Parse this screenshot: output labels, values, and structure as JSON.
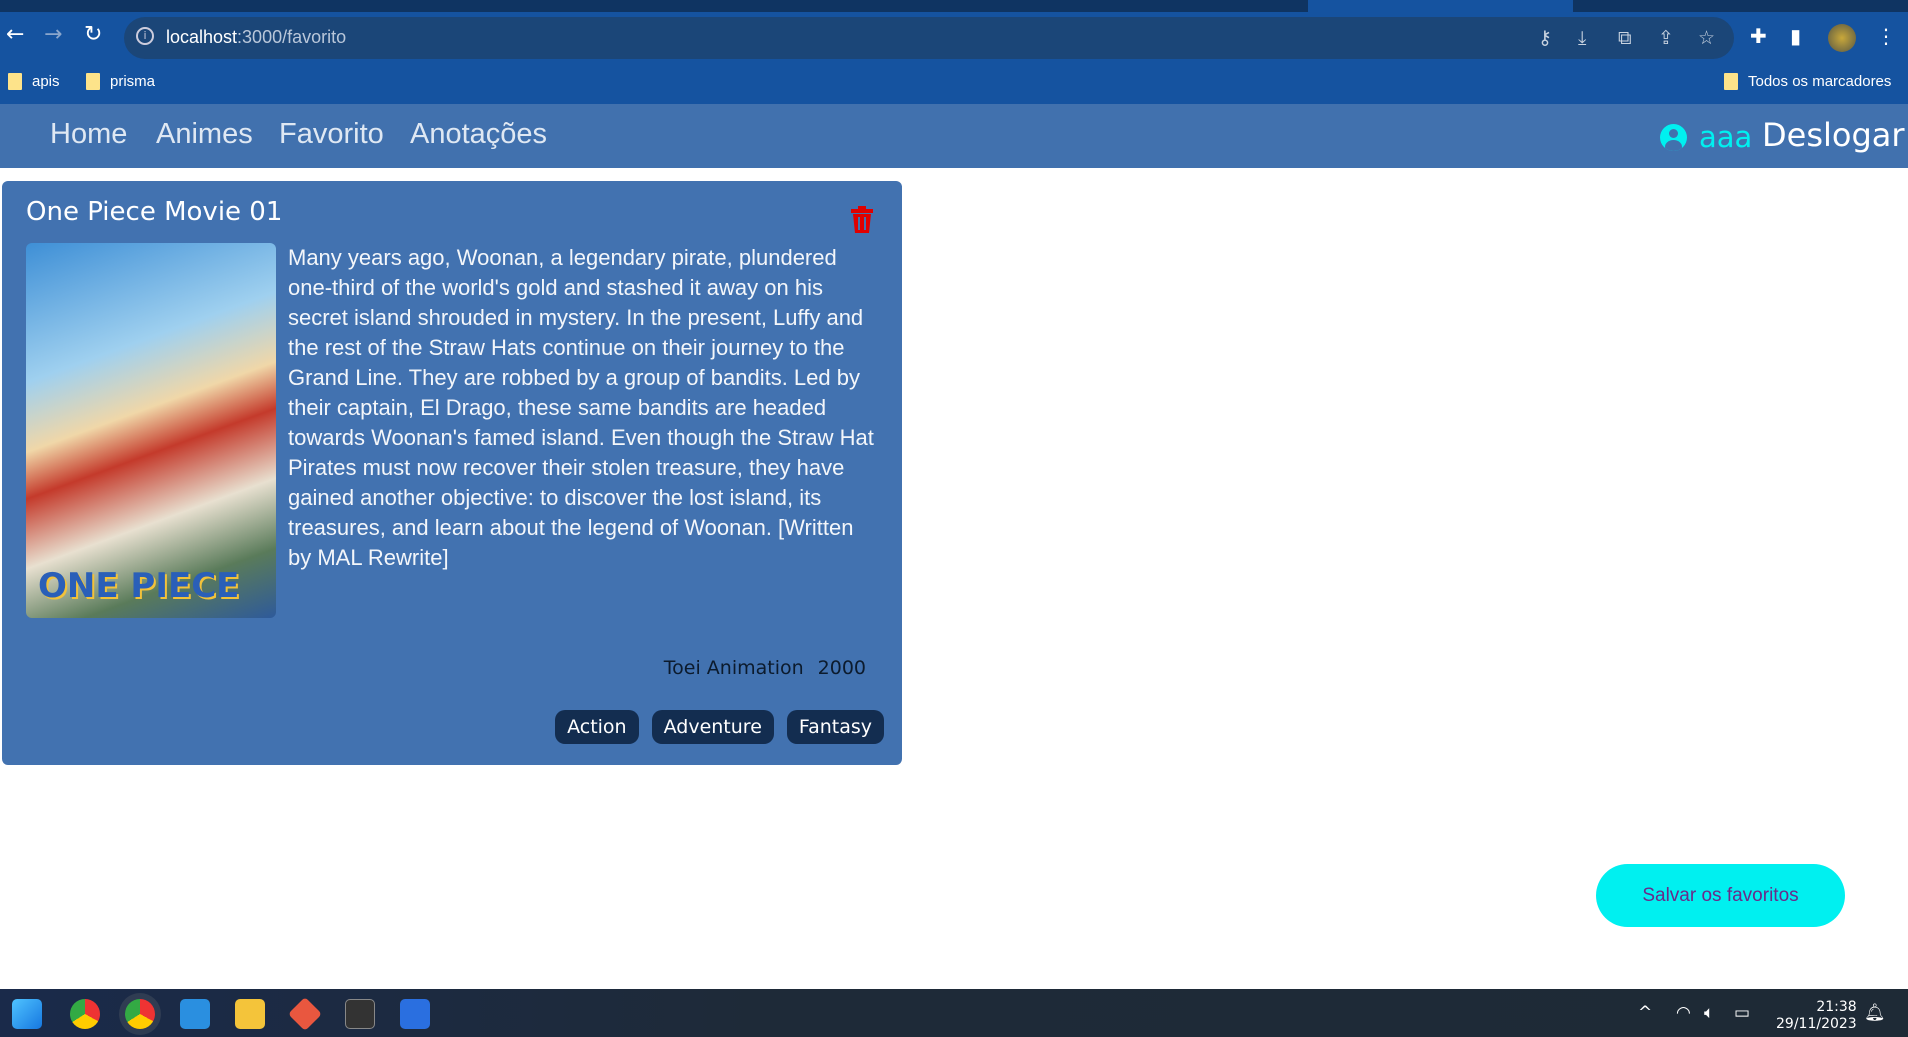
{
  "browser": {
    "url_host": "localhost",
    "url_path": ":3000/favorito",
    "bookmarks": [
      "apis",
      "prisma"
    ],
    "all_bookmarks": "Todos os marcadores"
  },
  "nav": {
    "links": [
      "Home",
      "Animes",
      "Favorito",
      "Anotações"
    ],
    "username": "aaa",
    "logout": "Deslogar"
  },
  "card": {
    "title": "One Piece Movie 01",
    "poster_text": "ONE PIECE",
    "description": "Many years ago, Woonan, a legendary pirate, plundered one-third of the world's gold and stashed it away on his secret island shrouded in mystery. In the present, Luffy and the rest of the Straw Hats continue on their journey to the Grand Line. They are robbed by a group of bandits. Led by their captain, El Drago, these same bandits are headed towards Woonan's famed island. Even though the Straw Hat Pirates must now recover their stolen treasure, they have gained another objective: to discover the lost island, its treasures, and learn about the legend of Woonan. [Written by MAL Rewrite]",
    "studio": "Toei Animation",
    "year": "2000",
    "genres": [
      "Action",
      "Adventure",
      "Fantasy"
    ]
  },
  "save_button": "Salvar os favoritos",
  "taskbar": {
    "time": "21:38",
    "date": "29/11/2023"
  },
  "colors": {
    "card": "#4272b0",
    "navbar": "#4171ae",
    "accent": "#00f0f0",
    "tag": "#132d50",
    "trash": "#e00000"
  }
}
